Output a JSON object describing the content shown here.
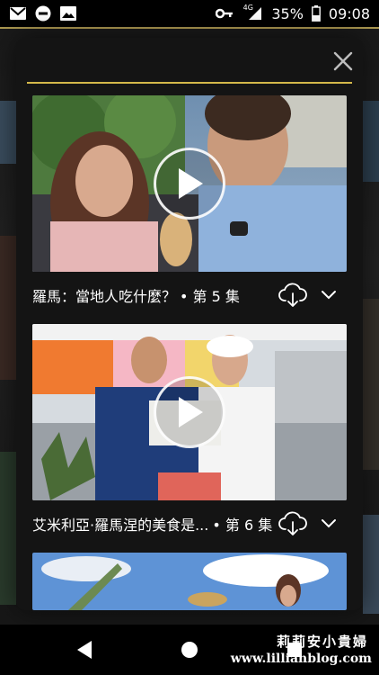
{
  "status_bar": {
    "left_icons": [
      "gmail-icon",
      "do-not-disturb-icon",
      "image-icon"
    ],
    "right_icons": [
      "key-icon",
      "signal-icon",
      "battery-icon"
    ],
    "network": "4G",
    "battery": "35%",
    "time": "09:08"
  },
  "episodes": [
    {
      "title": "羅馬：當地人吃什麼？",
      "episode": "• 第 5 集"
    },
    {
      "title": "艾米利亞·羅馬涅的美食是...",
      "episode": "• 第 6 集"
    }
  ],
  "watermark": {
    "line1": "莉莉安小貴婦",
    "line2": "www.lillianblog.com"
  },
  "colors": {
    "accent": "#d4b84a",
    "sheet_bg": "#141414"
  }
}
